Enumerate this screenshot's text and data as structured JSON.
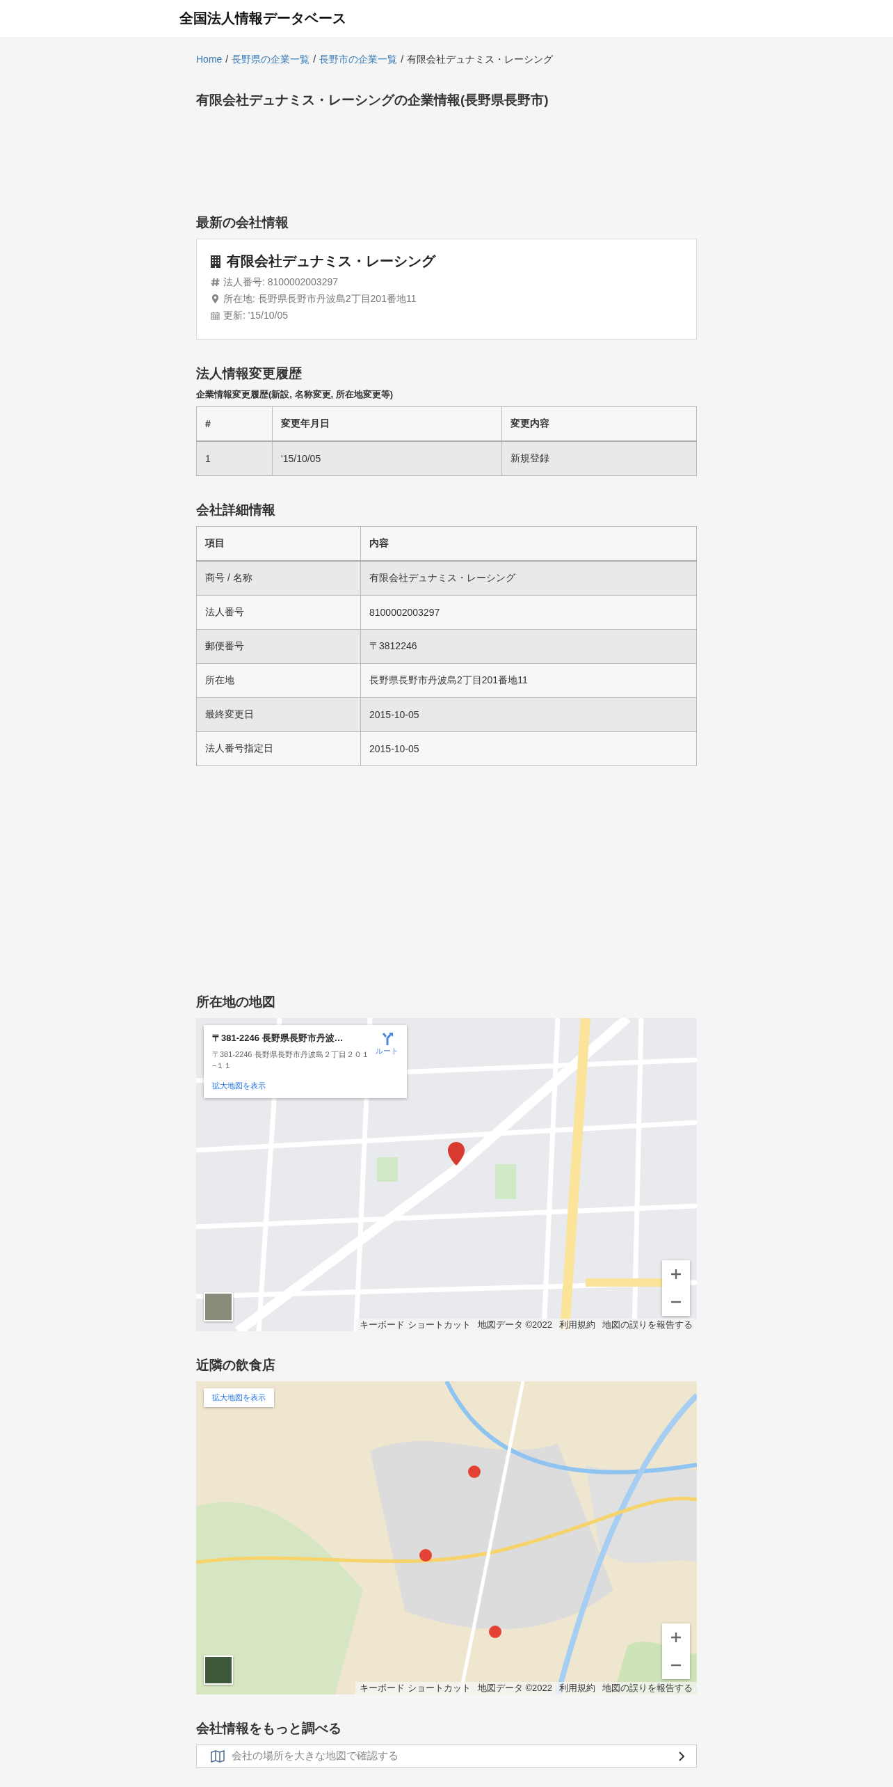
{
  "site_title": "全国法人情報データベース",
  "breadcrumb": [
    {
      "label": "Home",
      "link": true,
      "separator": "/"
    },
    {
      "label": "長野県の企業一覧",
      "link": true,
      "separator": "/"
    },
    {
      "label": "長野市の企業一覧",
      "link": true,
      "separator": "/"
    },
    {
      "label": "有限会社デュナミス・レーシング",
      "link": false
    }
  ],
  "page_title": "有限会社デュナミス・レーシングの企業情報(長野県長野市)",
  "latest": {
    "heading": "最新の会社情報",
    "name": "有限会社デュナミス・レーシング",
    "corporate_number": "法人番号: 8100002003297",
    "address": "所在地: 長野県長野市丹波島2丁目201番地11",
    "updated": "更新: '15/10/05"
  },
  "history": {
    "heading": "法人情報変更履歴",
    "caption": "企業情報変更履歴(新設, 名称変更, 所在地変更等)",
    "columns": [
      "#",
      "変更年月日",
      "変更内容"
    ],
    "rows": [
      [
        "1",
        "'15/10/05",
        "新規登録"
      ]
    ]
  },
  "details": {
    "heading": "会社詳細情報",
    "columns": [
      "項目",
      "内容"
    ],
    "rows": [
      [
        "商号 / 名称",
        "有限会社デュナミス・レーシング"
      ],
      [
        "法人番号",
        "8100002003297"
      ],
      [
        "郵便番号",
        "〒3812246"
      ],
      [
        "所在地",
        "長野県長野市丹波島2丁目201番地11"
      ],
      [
        "最終変更日",
        "2015-10-05"
      ],
      [
        "法人番号指定日",
        "2015-10-05"
      ]
    ]
  },
  "location_map": {
    "heading": "所在地の地図",
    "info_card": {
      "title": "〒381-2246 長野県長野市丹波…",
      "address": "〒381-2246 長野県長野市丹波島２丁目２０１−１１",
      "route_label": "ルート",
      "enlarge_link": "拡大地図を表示"
    },
    "footer": [
      "キーボード ショートカット",
      "地図データ ©2022",
      "利用規約",
      "地図の誤りを報告する"
    ]
  },
  "restaurants_map": {
    "heading": "近隣の飲食店",
    "enlarge_link": "拡大地図を表示",
    "footer": [
      "キーボード ショートカット",
      "地図データ ©2022",
      "利用規約",
      "地図の誤りを報告する"
    ]
  },
  "more": {
    "heading": "会社情報をもっと調べる",
    "links": [
      {
        "label": "会社の場所を大きな地図で確認する"
      }
    ]
  }
}
